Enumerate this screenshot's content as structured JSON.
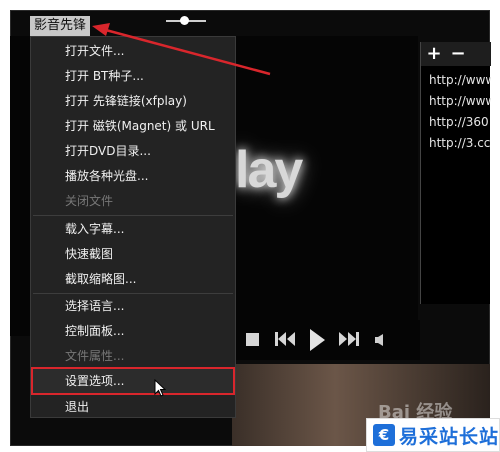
{
  "app": {
    "title": "影音先锋"
  },
  "player": {
    "logo_fragment": "lay",
    "bottom_watermark": "Bai 经验"
  },
  "playlist": {
    "add_label": "+",
    "remove_label": "−",
    "items": [
      "http://www",
      "http://www",
      "http://360",
      "http://3.cc"
    ]
  },
  "menu": {
    "items": [
      {
        "label": "打开文件...",
        "enabled": true
      },
      {
        "label": "打开 BT种子...",
        "enabled": true
      },
      {
        "label": "打开 先锋链接(xfplay)",
        "enabled": true
      },
      {
        "label": "打开 磁铁(Magnet) 或 URL",
        "enabled": true
      },
      {
        "label": "打开DVD目录...",
        "enabled": true
      },
      {
        "label": "播放各种光盘...",
        "enabled": true
      },
      {
        "label": "关闭文件",
        "enabled": false
      },
      {
        "label": "载入字幕...",
        "enabled": true
      },
      {
        "label": "快速截图",
        "enabled": true
      },
      {
        "label": "截取缩略图...",
        "enabled": true
      },
      {
        "label": "选择语言...",
        "enabled": true
      },
      {
        "label": "控制面板...",
        "enabled": true
      },
      {
        "label": "文件属性...",
        "enabled": false
      },
      {
        "label": "设置选项...",
        "enabled": true,
        "highlighted": true
      },
      {
        "label": "退出",
        "enabled": true
      }
    ]
  },
  "controls": {
    "icons": [
      "stop-icon",
      "previous-icon",
      "play-icon",
      "next-icon",
      "volume-icon"
    ]
  },
  "annotation": {
    "color": "#d9262c"
  },
  "badge": {
    "text": "易采站长站"
  }
}
